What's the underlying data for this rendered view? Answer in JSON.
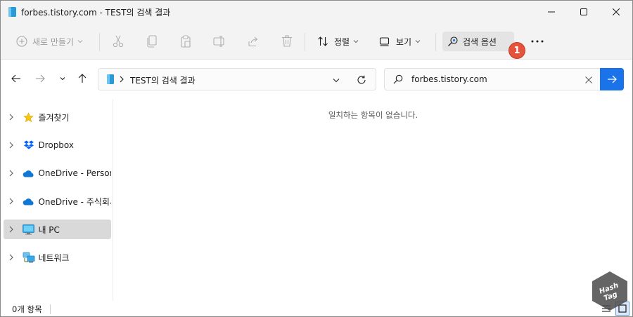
{
  "window": {
    "title": "forbes.tistory.com - TEST의 검색 결과"
  },
  "toolbar": {
    "new_label": "새로 만들기",
    "sort_label": "정렬",
    "view_label": "보기",
    "search_options_label": "검색 옵션",
    "badge_number": "1"
  },
  "address": {
    "path": "TEST의 검색 결과"
  },
  "search": {
    "value": "forbes.tistory.com"
  },
  "sidebar": {
    "items": [
      {
        "label": "즐겨찾기",
        "icon": "star-icon"
      },
      {
        "label": "Dropbox",
        "icon": "dropbox-icon"
      },
      {
        "label": "OneDrive - Persona",
        "icon": "onedrive-icon"
      },
      {
        "label": "OneDrive - 주식회사",
        "icon": "onedrive-icon"
      },
      {
        "label": "내 PC",
        "icon": "monitor-icon",
        "selected": true
      },
      {
        "label": "네트워크",
        "icon": "network-icon"
      }
    ]
  },
  "content": {
    "empty_message": "일치하는 항목이 없습니다."
  },
  "status": {
    "item_count": "0개 항목"
  },
  "watermark": {
    "line1": "Hash",
    "line2": "Tag"
  },
  "colors": {
    "accent": "#1a73e8",
    "badge": "#e5533c",
    "selected": "#d9d9d9",
    "chrome": "#f3f3f3"
  }
}
